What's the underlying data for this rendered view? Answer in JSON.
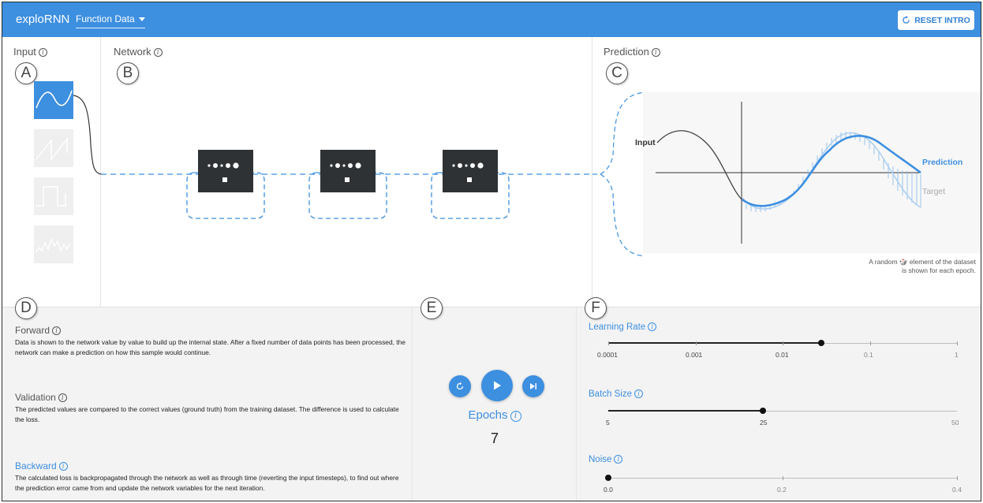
{
  "app": {
    "title": "exploRNN",
    "dataset_dropdown": "Function Data",
    "reset_button": "RESET INTRO"
  },
  "panels": {
    "input": {
      "title": "Input",
      "letter": "A"
    },
    "network": {
      "title": "Network",
      "letter": "B"
    },
    "prediction": {
      "title": "Prediction",
      "letter": "C",
      "labels": {
        "input": "Input",
        "prediction": "Prediction",
        "target": "Target"
      },
      "note_line1": "A random 🎲 element of the dataset",
      "note_line2": "is shown for each epoch."
    }
  },
  "sections": {
    "letter_d": "D",
    "letter_e": "E",
    "letter_f": "F",
    "forward": {
      "title": "Forward",
      "body": "Data is shown to the network value by value to build up the internal state. After a fixed number of data points has been processed, the network can make a prediction on how this sample would continue."
    },
    "validation": {
      "title": "Validation",
      "body": "The predicted values are compared to the correct values (ground truth) from the training dataset. The difference is used to calculate the loss."
    },
    "backward": {
      "title": "Backward",
      "body": "The calculated loss is backpropagated through the network as well as through time (reverting the input timesteps), to find out where the prediction error came from and update the network variables for the next iteration."
    }
  },
  "training": {
    "epochs_label": "Epochs",
    "epochs_value": "7"
  },
  "sliders": {
    "learning_rate": {
      "title": "Learning Rate",
      "ticks": [
        "0.0001",
        "0.001",
        "0.01",
        "0.1",
        "1"
      ],
      "value_position": 0.61
    },
    "batch_size": {
      "title": "Batch Size",
      "ticks": [
        "5",
        "25",
        "50"
      ],
      "value": 25
    },
    "noise": {
      "title": "Noise",
      "ticks": [
        "0.0",
        "0.2",
        "0.4"
      ],
      "value": 0.0
    }
  },
  "colors": {
    "accent": "#3d8fe0",
    "block": "#2f3235"
  }
}
